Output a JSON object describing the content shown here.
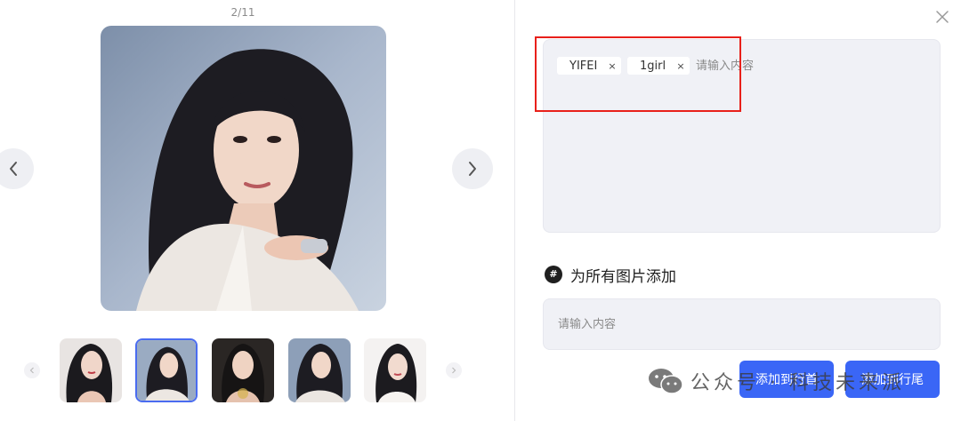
{
  "viewer": {
    "counter": "2/11",
    "prev_icon": "chevron-left-icon",
    "next_icon": "chevron-right-icon",
    "thumbnails": [
      {
        "name": "thumbnail-1",
        "selected": false
      },
      {
        "name": "thumbnail-2",
        "selected": true
      },
      {
        "name": "thumbnail-3",
        "selected": false
      },
      {
        "name": "thumbnail-4",
        "selected": false
      },
      {
        "name": "thumbnail-5",
        "selected": false
      }
    ]
  },
  "editor": {
    "close_icon": "close-icon",
    "tags": [
      "YIFEI",
      "1girl"
    ],
    "tag_remove_symbol": "×",
    "tag_input_placeholder": "请输入内容",
    "section_icon": "#",
    "section_title": "为所有图片添加",
    "all_input_placeholder": "请输入内容",
    "add_to_head_label": "添加到行首",
    "add_to_tail_label": "添加到行尾"
  },
  "watermark": {
    "text": "公众号 · 科技未来派"
  },
  "colors": {
    "accent": "#3a66f6",
    "highlight": "#e8201a",
    "input_bg": "#f0f1f6",
    "selected_border": "#4a6cf0"
  }
}
